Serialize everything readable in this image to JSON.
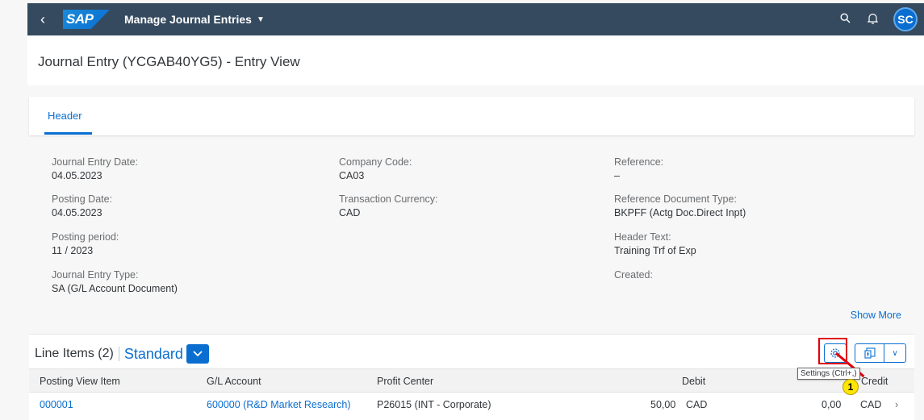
{
  "shell": {
    "logo": "SAP",
    "app_title": "Manage Journal Entries",
    "avatar_initials": "SC"
  },
  "page": {
    "title": "Journal Entry (YCGAB40YG5) - Entry View"
  },
  "tabs": [
    {
      "label": "Header"
    }
  ],
  "header_fields": {
    "journal_entry_date": {
      "label": "Journal Entry Date:",
      "value": "04.05.2023"
    },
    "posting_date": {
      "label": "Posting Date:",
      "value": "04.05.2023"
    },
    "posting_period": {
      "label": "Posting period:",
      "value": "11 / 2023"
    },
    "journal_entry_type": {
      "label": "Journal Entry Type:",
      "value": "SA (G/L Account Document)"
    },
    "company_code": {
      "label": "Company Code:",
      "value": "CA03"
    },
    "transaction_currency": {
      "label": "Transaction Currency:",
      "value": "CAD"
    },
    "reference": {
      "label": "Reference:",
      "value": "–"
    },
    "reference_document_type": {
      "label": "Reference Document Type:",
      "value": "BKPFF (Actg Doc.Direct Inpt)"
    },
    "header_text": {
      "label": "Header Text:",
      "value": "Training Trf of Exp"
    },
    "created": {
      "label": "Created:",
      "value": ""
    }
  },
  "show_more_label": "Show More",
  "line_items": {
    "title": "Line Items (2)",
    "variant": "Standard",
    "tooltip": "Settings (Ctrl+,)",
    "callout_number": "1",
    "columns": [
      "Posting View Item",
      "G/L Account",
      "Profit Center",
      "Debit",
      "Credit"
    ],
    "rows": [
      {
        "item": "000001",
        "gl_account": "600000 (R&D Market Research)",
        "profit_center": "P26015 (INT - Corporate)",
        "debit": "50,00",
        "debit_currency": "CAD",
        "credit": "0,00",
        "credit_currency": "CAD"
      }
    ]
  },
  "colors": {
    "shell_bg": "#354a5f",
    "accent": "#0a6ed1",
    "highlight": "#e0000a",
    "callout": "#ffe600"
  }
}
